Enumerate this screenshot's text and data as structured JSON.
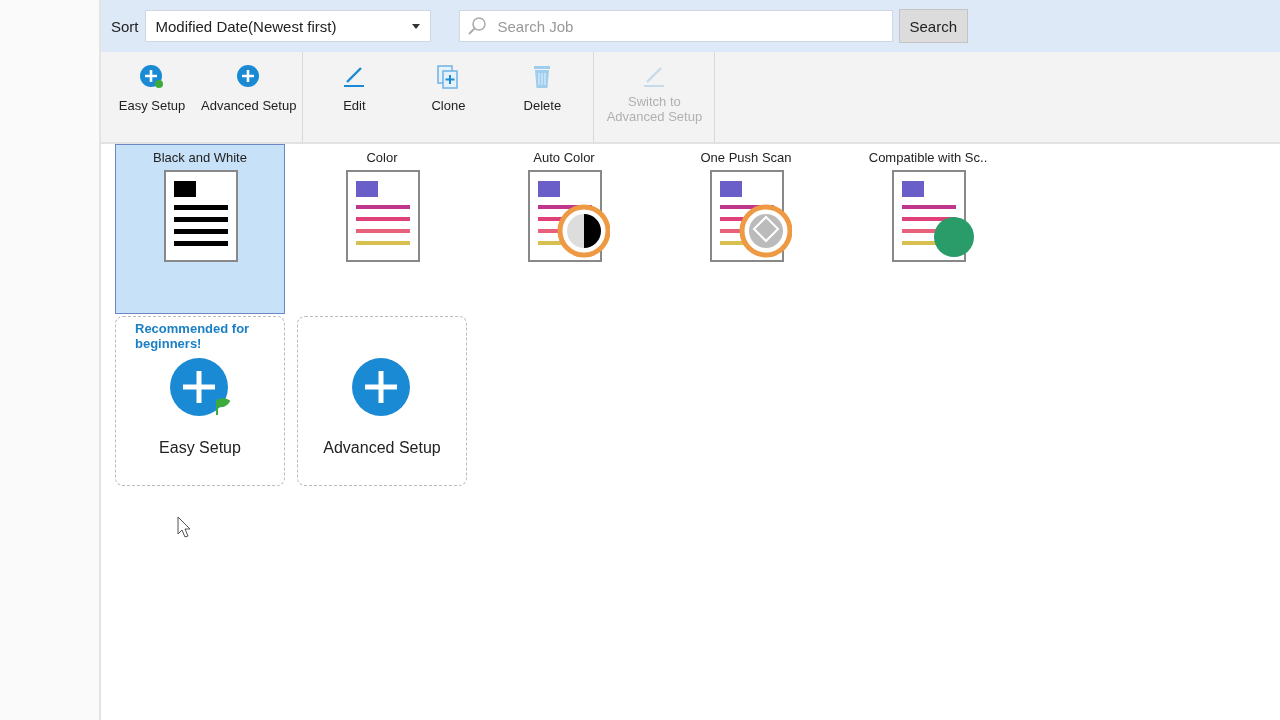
{
  "sort": {
    "label": "Sort",
    "value": "Modified Date(Newest first)"
  },
  "search": {
    "placeholder": "Search Job",
    "button": "Search"
  },
  "toolbar": [
    [
      {
        "label": "Easy Setup",
        "kind": "easy",
        "disabled": false
      },
      {
        "label": "Advanced Setup",
        "kind": "advanced",
        "disabled": false
      }
    ],
    [
      {
        "label": "Edit",
        "kind": "edit",
        "disabled": false
      },
      {
        "label": "Clone",
        "kind": "clone",
        "disabled": false
      },
      {
        "label": "Delete",
        "kind": "delete",
        "disabled": false
      }
    ],
    [
      {
        "label": "Switch to Advanced Setup",
        "kind": "switch",
        "disabled": true
      }
    ]
  ],
  "jobs": [
    {
      "label": "Black and White",
      "kind": "bw",
      "selected": true
    },
    {
      "label": "Color",
      "kind": "color",
      "selected": false
    },
    {
      "label": "Auto Color",
      "kind": "auto",
      "selected": false
    },
    {
      "label": "One Push Scan",
      "kind": "onepush",
      "selected": false
    },
    {
      "label": "Compatible with Sc..",
      "kind": "fi",
      "selected": false
    }
  ],
  "create": [
    {
      "kind": "easy",
      "note": "Recommended for beginners!",
      "label": "Easy Setup"
    },
    {
      "kind": "advanced",
      "label": "Advanced Setup"
    }
  ]
}
